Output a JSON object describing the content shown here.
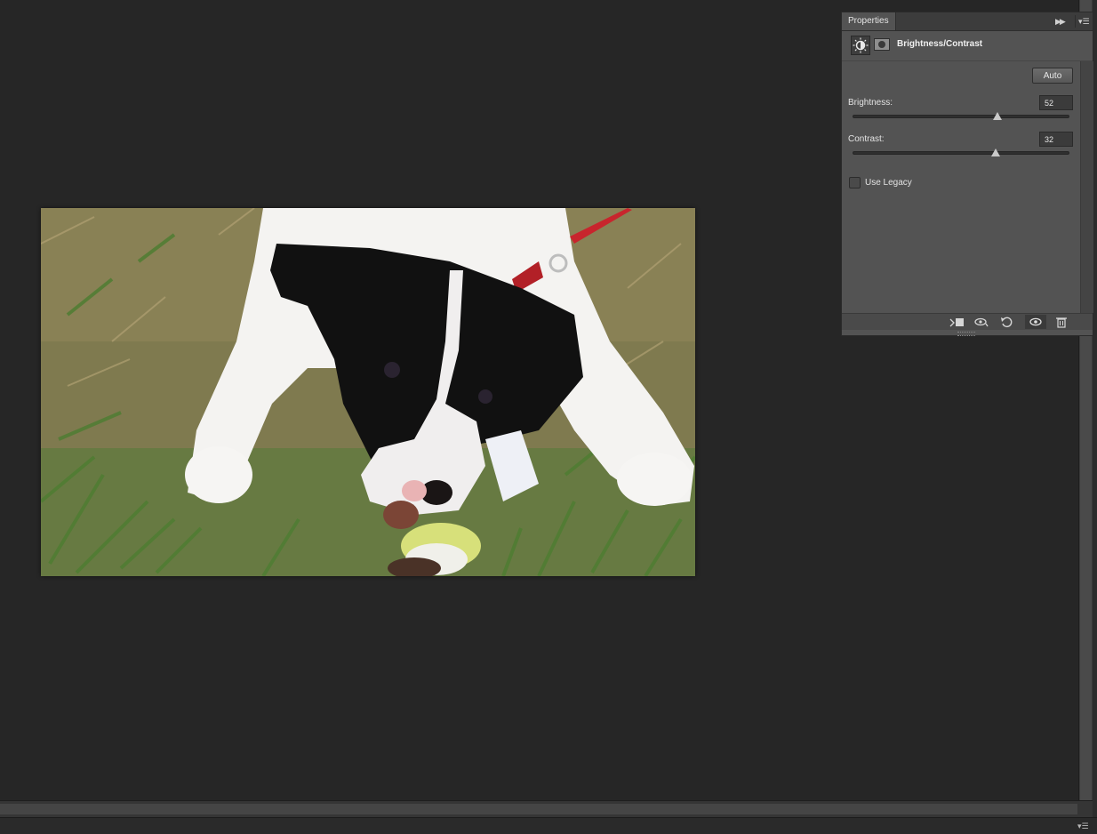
{
  "panel": {
    "tab_label": "Properties",
    "adjustment_title": "Brightness/Contrast",
    "auto_label": "Auto",
    "brightness": {
      "label": "Brightness:",
      "value": "52",
      "slider_fraction": 0.67
    },
    "contrast": {
      "label": "Contrast:",
      "value": "32",
      "slider_fraction": 0.66
    },
    "use_legacy": {
      "label": "Use Legacy",
      "checked": false
    },
    "footer_icons": [
      "clip-to-layer-icon",
      "view-previous-state-icon",
      "reset-icon",
      "visibility-icon",
      "trash-icon"
    ]
  },
  "canvas": {
    "image_subject": "dog-photo"
  },
  "colors": {
    "workspace": "#262626",
    "panel": "#535353"
  }
}
